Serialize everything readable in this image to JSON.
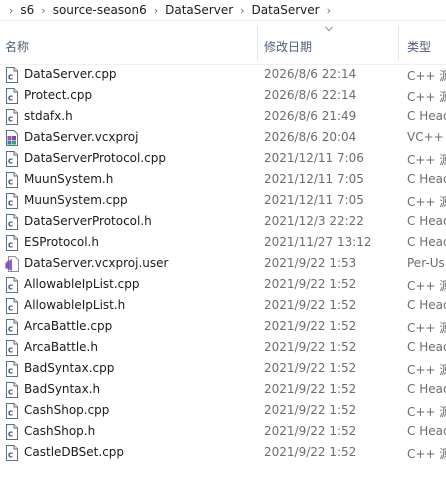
{
  "breadcrumb": [
    "s6",
    "source-season6",
    "DataServer",
    "DataServer"
  ],
  "columns": {
    "name": "名称",
    "date": "修改日期",
    "type": "类型"
  },
  "files": [
    {
      "name": "DataServer.cpp",
      "date": "2026/8/6 22:14",
      "type": "C++ 源",
      "icon": "cpp-file-icon"
    },
    {
      "name": "Protect.cpp",
      "date": "2026/8/6 22:14",
      "type": "C++ 源",
      "icon": "cpp-file-icon"
    },
    {
      "name": "stdafx.h",
      "date": "2026/8/6 21:49",
      "type": "C Head",
      "icon": "header-file-icon"
    },
    {
      "name": "DataServer.vcxproj",
      "date": "2026/8/6 20:04",
      "type": "VC++",
      "icon": "vcxproj-file-icon"
    },
    {
      "name": "DataServerProtocol.cpp",
      "date": "2021/12/11 7:06",
      "type": "C++ 源",
      "icon": "cpp-file-icon"
    },
    {
      "name": "MuunSystem.h",
      "date": "2021/12/11 7:05",
      "type": "C Head",
      "icon": "header-file-icon"
    },
    {
      "name": "MuunSystem.cpp",
      "date": "2021/12/11 7:05",
      "type": "C++ 源",
      "icon": "cpp-file-icon"
    },
    {
      "name": "DataServerProtocol.h",
      "date": "2021/12/3 22:22",
      "type": "C Head",
      "icon": "header-file-icon"
    },
    {
      "name": "ESProtocol.h",
      "date": "2021/11/27 13:12",
      "type": "C Head",
      "icon": "header-file-icon"
    },
    {
      "name": "DataServer.vcxproj.user",
      "date": "2021/9/22 1:53",
      "type": "Per-Us",
      "icon": "vs-user-file-icon"
    },
    {
      "name": "AllowableIpList.cpp",
      "date": "2021/9/22 1:52",
      "type": "C++ 源",
      "icon": "cpp-file-icon"
    },
    {
      "name": "AllowableIpList.h",
      "date": "2021/9/22 1:52",
      "type": "C Head",
      "icon": "header-file-icon"
    },
    {
      "name": "ArcaBattle.cpp",
      "date": "2021/9/22 1:52",
      "type": "C++ 源",
      "icon": "cpp-file-icon"
    },
    {
      "name": "ArcaBattle.h",
      "date": "2021/9/22 1:52",
      "type": "C Head",
      "icon": "header-file-icon"
    },
    {
      "name": "BadSyntax.cpp",
      "date": "2021/9/22 1:52",
      "type": "C++ 源",
      "icon": "cpp-file-icon"
    },
    {
      "name": "BadSyntax.h",
      "date": "2021/9/22 1:52",
      "type": "C Head",
      "icon": "header-file-icon"
    },
    {
      "name": "CashShop.cpp",
      "date": "2021/9/22 1:52",
      "type": "C++ 源",
      "icon": "cpp-file-icon"
    },
    {
      "name": "CashShop.h",
      "date": "2021/9/22 1:52",
      "type": "C Head",
      "icon": "header-file-icon"
    },
    {
      "name": "CastleDBSet.cpp",
      "date": "2021/9/22 1:52",
      "type": "C++ 源",
      "icon": "cpp-file-icon"
    }
  ]
}
